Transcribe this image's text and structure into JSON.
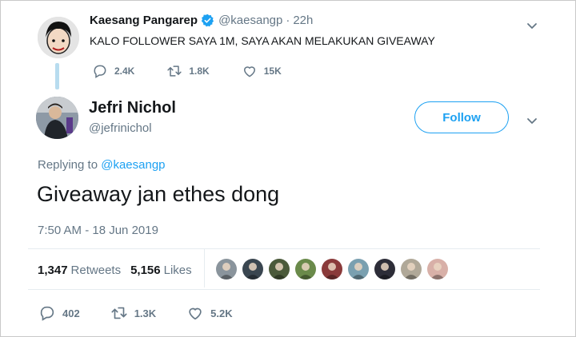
{
  "parent_tweet": {
    "name": "Kaesang Pangarep",
    "handle": "@kaesangp",
    "separator": "·",
    "time": "22h",
    "text": "KALO FOLLOWER SAYA 1M, SAYA AKAN MELAKUKAN GIVEAWAY",
    "replies": "2.4K",
    "retweets": "1.8K",
    "likes": "15K"
  },
  "main_tweet": {
    "name": "Jefri Nichol",
    "handle": "@jefrinichol",
    "follow_label": "Follow",
    "replying_prefix": "Replying to",
    "replying_handle": "@kaesangp",
    "text": "Giveaway jan ethes dong",
    "timestamp": "7:50 AM - 18 Jun 2019",
    "retweet_count": "1,347",
    "retweet_label": "Retweets",
    "like_count": "5,156",
    "like_label": "Likes",
    "replies": "402",
    "retweets": "1.3K",
    "likes": "5.2K"
  },
  "colors": {
    "accent": "#1da1f2",
    "muted": "#657786",
    "thread_line": "#b8dcef",
    "liker_avatars": [
      "#8a949c",
      "#3a4650",
      "#4b5a3a",
      "#6a8a4a",
      "#8a3a3a",
      "#7aa0b0",
      "#2d2d38",
      "#b0a898",
      "#d8b0a8"
    ]
  }
}
